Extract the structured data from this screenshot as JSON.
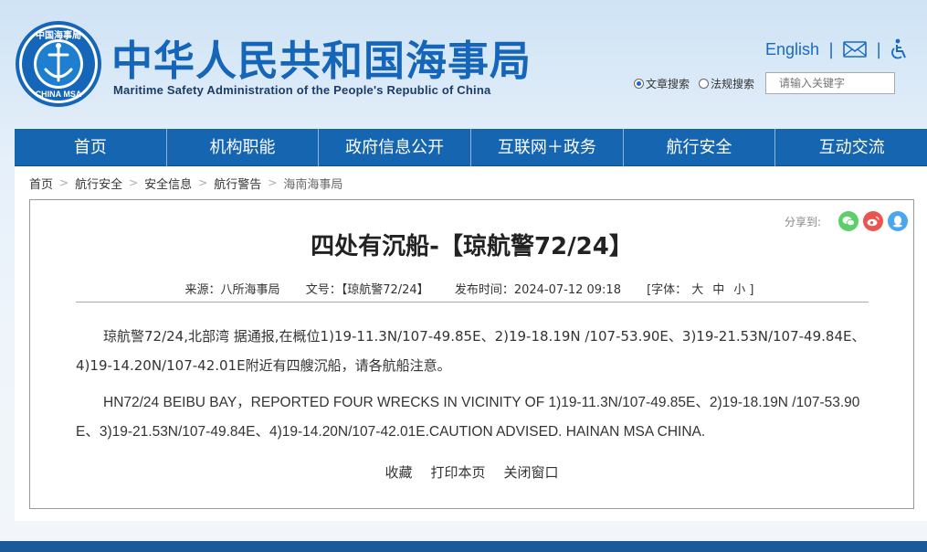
{
  "header": {
    "title_cn": "中华人民共和国海事局",
    "title_en": "Maritime Safety Administration of the People's Republic of China",
    "logo_text_top": "中国海事局",
    "logo_text_bottom": "CHINA MSA",
    "lang_link": "English",
    "sep1": "|",
    "sep2": "|",
    "search": {
      "option_article": "文章搜索",
      "option_law": "法规搜索",
      "placeholder": "请输入关键字"
    }
  },
  "nav": [
    {
      "label": "首页"
    },
    {
      "label": "机构职能"
    },
    {
      "label": "政府信息公开"
    },
    {
      "label": "互联网＋政务"
    },
    {
      "label": "航行安全"
    },
    {
      "label": "互动交流"
    }
  ],
  "breadcrumb": [
    "首页",
    "航行安全",
    "安全信息",
    "航行警告",
    "海南海事局"
  ],
  "article": {
    "share_label": "分享到:",
    "title": "四处有沉船-【琼航警72/24】",
    "meta": {
      "source": "来源：八所海事局",
      "doc_no": "文号：【琼航警72/24】",
      "publish_time": "发布时间：2024-07-12 09:18",
      "font_label": "[字体：",
      "font_large": "大",
      "font_mid": "中",
      "font_small": "小 ]"
    },
    "para_cn": "琼航警72/24,北部湾 据通报,在概位1)19-11.3N/107-49.85E、2)19-18.19N /107-53.90E、3)19-21.53N/107-49.84E、4)19-14.20N/107-42.01E附近有四艘沉船，请各航船注意。",
    "para_en": "HN72/24 BEIBU BAY，REPORTED FOUR  WRECKS IN VICINITY OF 1)19-11.3N/107-49.85E、2)19-18.19N /107-53.90E、3)19-21.53N/107-49.84E、4)19-14.20N/107-42.01E.CAUTION ADVISED. HAINAN MSA CHINA.",
    "actions": {
      "favorite": "收藏",
      "print": "打印本页",
      "close": "关闭窗口"
    }
  },
  "colors": {
    "brand_blue": "#1565b0",
    "title_blue": "#1565b8"
  }
}
